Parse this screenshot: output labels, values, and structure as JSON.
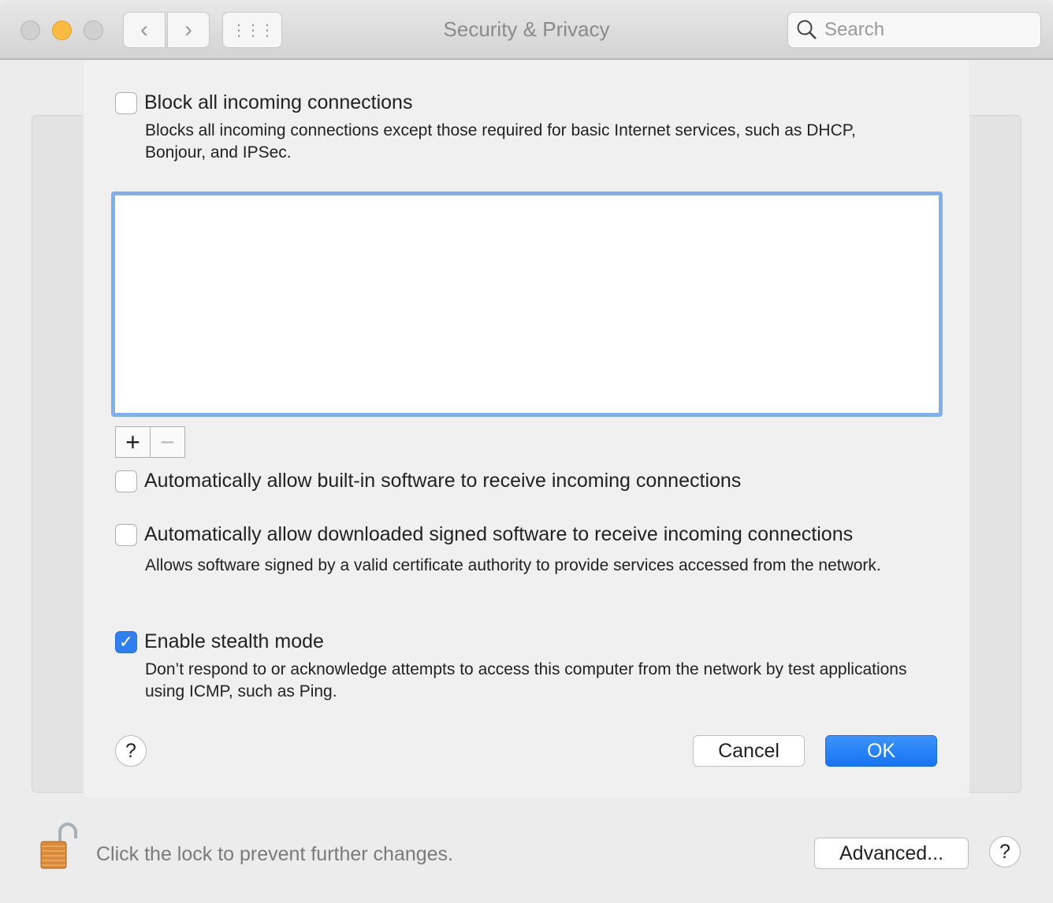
{
  "window": {
    "title": "Security & Privacy",
    "search_placeholder": "Search"
  },
  "toolbar": {
    "back": "‹",
    "forward": "›",
    "grid": "⋮⋮⋮"
  },
  "sheet": {
    "block_all": {
      "label": "Block all incoming connections",
      "checked": false,
      "desc": "Blocks all incoming connections except those required for basic Internet services, such as DHCP, Bonjour, and IPSec."
    },
    "add": "+",
    "remove": "−",
    "builtin": {
      "label": "Automatically allow built-in software to receive incoming connections",
      "checked": false
    },
    "signed": {
      "label": "Automatically allow downloaded signed software to receive incoming connections",
      "checked": false,
      "desc": "Allows software signed by a valid certificate authority to provide services accessed from the network."
    },
    "stealth": {
      "label": "Enable stealth mode",
      "checked": true,
      "desc": "Don’t respond to or acknowledge attempts to access this computer from the network by test applications using ICMP, such as Ping."
    },
    "help": "?",
    "cancel": "Cancel",
    "ok": "OK",
    "accent": "#1a7ef5"
  },
  "footer": {
    "lock_text": "Click the lock to prevent further changes.",
    "advanced": "Advanced...",
    "help": "?"
  }
}
